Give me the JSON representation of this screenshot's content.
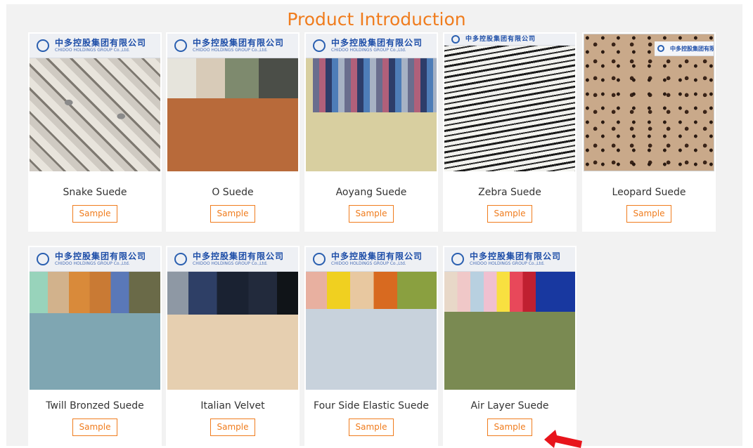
{
  "section": {
    "title": "Product Introduction"
  },
  "banner": {
    "cn": "中多控股集团有限公司",
    "en": "CHIDOO HOLDINGS GROUP Co.,Ltd."
  },
  "products": [
    {
      "name": "Snake Suede",
      "button": "Sample"
    },
    {
      "name": "O Suede",
      "button": "Sample"
    },
    {
      "name": "Aoyang Suede",
      "button": "Sample"
    },
    {
      "name": "Zebra Suede",
      "button": "Sample"
    },
    {
      "name": "Leopard Suede",
      "button": "Sample"
    },
    {
      "name": "Twill Bronzed Suede",
      "button": "Sample"
    },
    {
      "name": "Italian Velvet",
      "button": "Sample"
    },
    {
      "name": "Four Side Elastic Suede",
      "button": "Sample"
    },
    {
      "name": "Air Layer Suede",
      "button": "Sample"
    }
  ],
  "colors": {
    "accent": "#f07c1d",
    "background": "#f2f2f2",
    "arrow": "#e8141b"
  }
}
